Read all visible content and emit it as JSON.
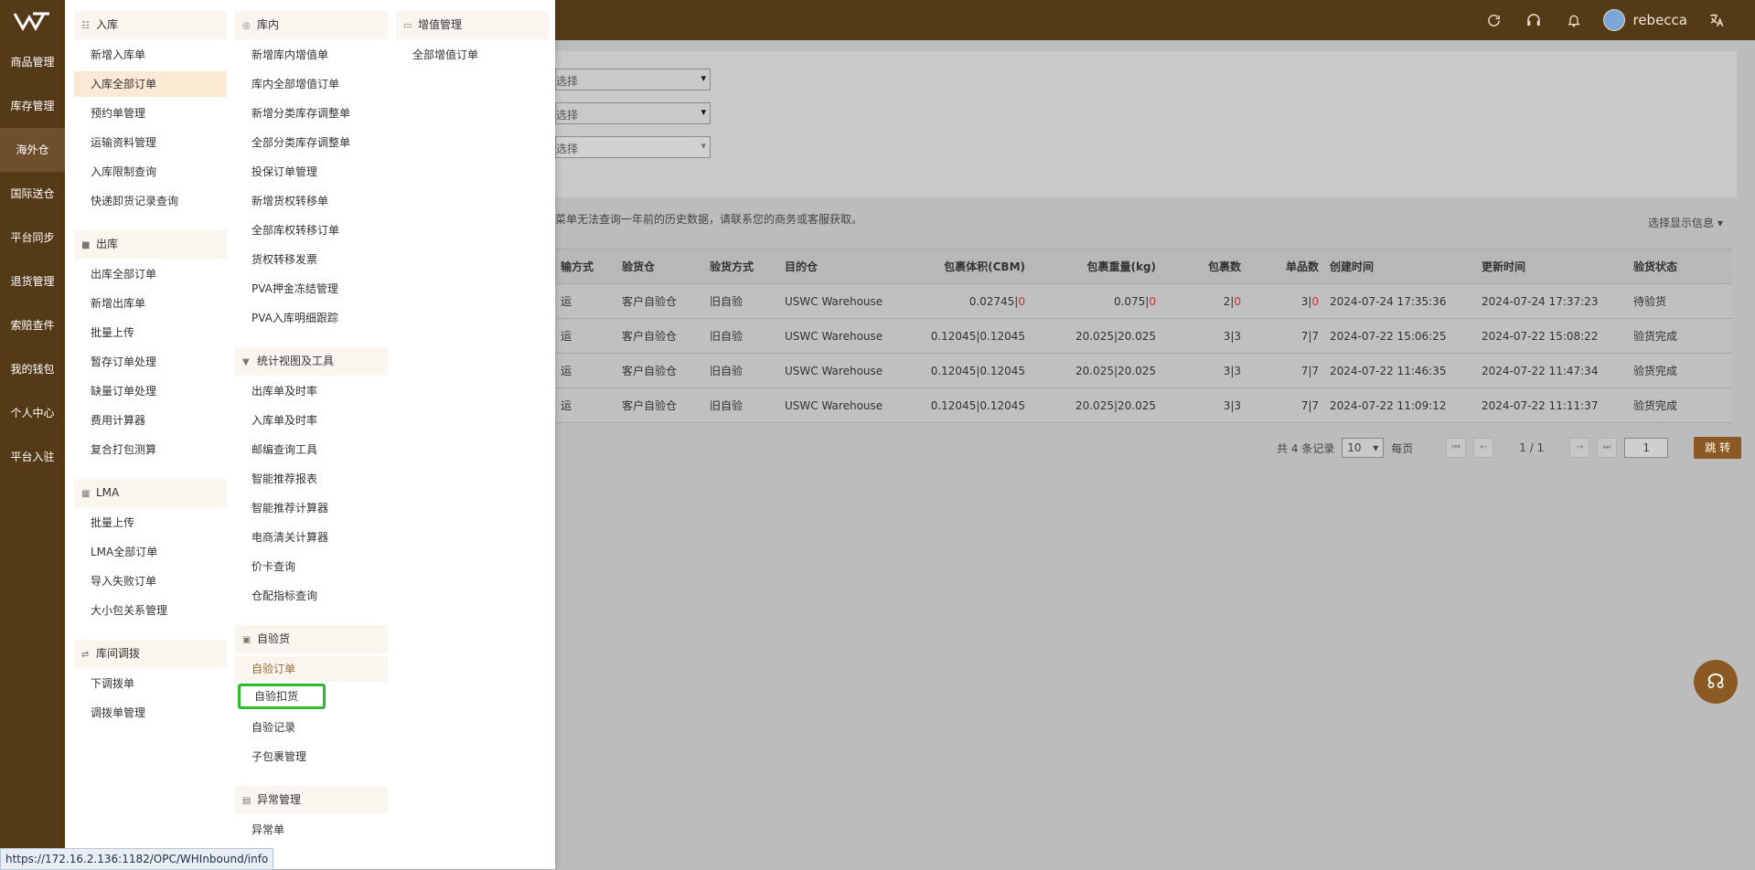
{
  "top": {
    "user_name": "rebecca",
    "icons": [
      "refresh-icon",
      "headset-icon",
      "bell-icon",
      "translate-icon"
    ]
  },
  "sidebar": {
    "items": [
      "商品管理",
      "库存管理",
      "海外仓",
      "国际送仓",
      "平台同步",
      "退货管理",
      "索赔查件",
      "我的钱包",
      "个人中心",
      "平台入驻"
    ],
    "active_index": 2
  },
  "menu": {
    "col1": {
      "inbound": {
        "title": "入库",
        "items": [
          "新增入库单",
          "入库全部订单",
          "预约单管理",
          "运输资料管理",
          "入库限制查询",
          "快递卸货记录查询"
        ]
      },
      "outbound": {
        "title": "出库",
        "items": [
          "出库全部订单",
          "新增出库单",
          "批量上传",
          "暂存订单处理",
          "缺量订单处理",
          "费用计算器",
          "复合打包测算"
        ]
      },
      "lma": {
        "title": "LMA",
        "items": [
          "批量上传",
          "LMA全部订单",
          "导入失败订单",
          "大小包关系管理"
        ]
      },
      "transfer": {
        "title": "库间调拨",
        "items": [
          "下调拨单",
          "调拨单管理"
        ]
      }
    },
    "col2": {
      "inwarehouse": {
        "title": "库内",
        "items": [
          "新增库内增值单",
          "库内全部增值订单",
          "新增分类库存调整单",
          "全部分类库存调整单",
          "投保订单管理",
          "新增货权转移单",
          "全部库权转移订单",
          "货权转移发票",
          "PVA押金冻结管理",
          "PVA入库明细跟踪"
        ]
      },
      "stats": {
        "title": "统计视图及工具",
        "items": [
          "出库单及时率",
          "入库单及时率",
          "邮编查询工具",
          "智能推荐报表",
          "智能推荐计算器",
          "电商清关计算器",
          "价卡查询",
          "仓配指标查询"
        ]
      },
      "selfcheck": {
        "title": "自验货",
        "items": [
          "自验订单",
          "自验扣货",
          "自验记录",
          "子包裹管理"
        ]
      },
      "exception": {
        "title": "异常管理",
        "items": [
          "异常单"
        ]
      }
    },
    "col3": {
      "valueadded": {
        "title": "增值管理",
        "items": [
          "全部增值订单"
        ]
      }
    }
  },
  "filters": {
    "select1": "选择",
    "select2": "选择",
    "select3": "选择"
  },
  "notice": "菜单无法查询一年前的历史数据，请联系您的商务或客服获取。",
  "display_info": "选择显示信息",
  "table": {
    "headers": [
      "输方式",
      "验货仓",
      "验货方式",
      "目的仓",
      "包裹体积(CBM)",
      "包裹重量(kg)",
      "包裹数",
      "单品数",
      "创建时间",
      "更新时间",
      "验货状态"
    ],
    "rows": [
      {
        "mode": "运",
        "warehouse": "客户自验仓",
        "method": "旧自验",
        "destination": "USWC Warehouse",
        "volume_main": "0.02745|",
        "volume_red": "0",
        "weight_main": "0.075|",
        "weight_red": "0",
        "packages_main": "2|",
        "packages_red": "0",
        "items_main": "3|",
        "items_red": "0",
        "created": "2024-07-24 17:35:36",
        "updated": "2024-07-24 17:37:23",
        "status": "待验货"
      },
      {
        "mode": "运",
        "warehouse": "客户自验仓",
        "method": "旧自验",
        "destination": "USWC Warehouse",
        "volume": "0.12045|0.12045",
        "weight": "20.025|20.025",
        "packages": "3|3",
        "items": "7|7",
        "created": "2024-07-22 15:06:25",
        "updated": "2024-07-22 15:08:22",
        "status": "验货完成"
      },
      {
        "mode": "运",
        "warehouse": "客户自验仓",
        "method": "旧自验",
        "destination": "USWC Warehouse",
        "volume": "0.12045|0.12045",
        "weight": "20.025|20.025",
        "packages": "3|3",
        "items": "7|7",
        "created": "2024-07-22 11:46:35",
        "updated": "2024-07-22 11:47:34",
        "status": "验货完成"
      },
      {
        "mode": "运",
        "warehouse": "客户自验仓",
        "method": "旧自验",
        "destination": "USWC Warehouse",
        "volume": "0.12045|0.12045",
        "weight": "20.025|20.025",
        "packages": "3|3",
        "items": "7|7",
        "created": "2024-07-22 11:09:12",
        "updated": "2024-07-22 11:11:37",
        "status": "验货完成"
      }
    ]
  },
  "pager": {
    "total": "共 4 条记录",
    "page_size": "10",
    "per_page": "每页",
    "page_status": "1 / 1",
    "input": "1",
    "jump": "跳 转"
  },
  "url_hint": "https://172.16.2.136:1182/OPC/WHInbound/info"
}
